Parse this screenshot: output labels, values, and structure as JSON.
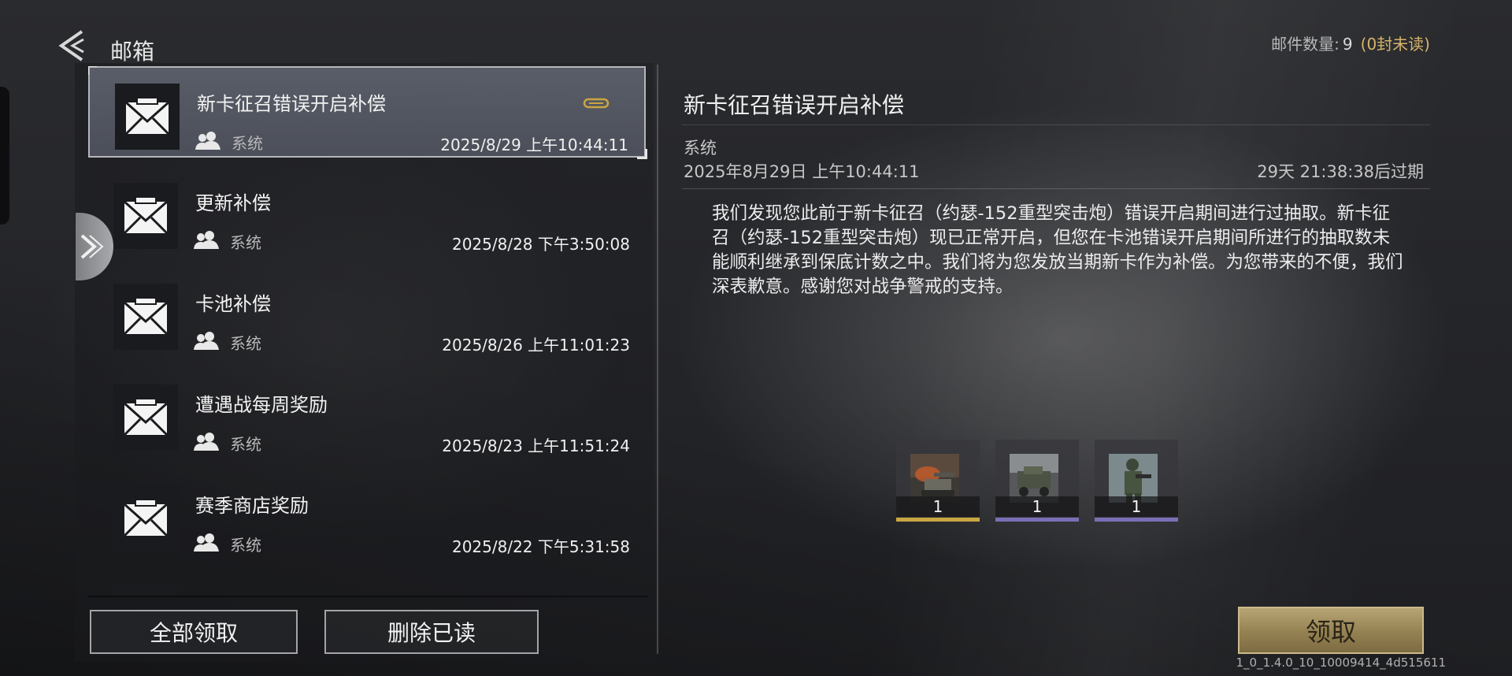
{
  "header": {
    "title": "邮箱",
    "mail_count_label": "邮件数量:",
    "mail_count": "9",
    "unread_label": "(0封未读)"
  },
  "colors": {
    "accent_gold": "#d6b56a",
    "rarity_gold": "#c9a640",
    "rarity_purple": "#7a6fb6"
  },
  "mails": [
    {
      "title": "新卡征召错误开启补偿",
      "sender": "系统",
      "date": "2025/8/29 上午10:44:11",
      "has_attachment": true,
      "selected": true
    },
    {
      "title": "更新补偿",
      "sender": "系统",
      "date": "2025/8/28 下午3:50:08",
      "has_attachment": false,
      "selected": false
    },
    {
      "title": "卡池补偿",
      "sender": "系统",
      "date": "2025/8/26 上午11:01:23",
      "has_attachment": false,
      "selected": false
    },
    {
      "title": "遭遇战每周奖励",
      "sender": "系统",
      "date": "2025/8/23 上午11:51:24",
      "has_attachment": false,
      "selected": false
    },
    {
      "title": "赛季商店奖励",
      "sender": "系统",
      "date": "2025/8/22 下午5:31:58",
      "has_attachment": false,
      "selected": false
    }
  ],
  "actions": {
    "claim_all": "全部领取",
    "delete_read": "删除已读",
    "claim": "领取"
  },
  "detail": {
    "title": "新卡征召错误开启补偿",
    "sender": "系统",
    "time": "2025年8月29日 上午10:44:11",
    "expire": "29天 21:38:38后过期",
    "body": "我们发现您此前于新卡征召（约瑟-152重型突击炮）错误开启期间进行过抽取。新卡征召（约瑟-152重型突击炮）现已正常开启，但您在卡池错误开启期间所进行的抽取数未能顺利继承到保底计数之中。我们将为您发放当期新卡作为补偿。为您带来的不便，我们深表歉意。感谢您对战争警戒的支持。",
    "attachments": [
      {
        "icon": "artillery-card-icon",
        "qty": "1",
        "rarity": "gold"
      },
      {
        "icon": "armored-vehicle-card-icon",
        "qty": "1",
        "rarity": "purple"
      },
      {
        "icon": "soldier-card-icon",
        "qty": "1",
        "rarity": "purple"
      }
    ]
  },
  "version": "1_0_1.4.0_10_10009414_4d515611"
}
